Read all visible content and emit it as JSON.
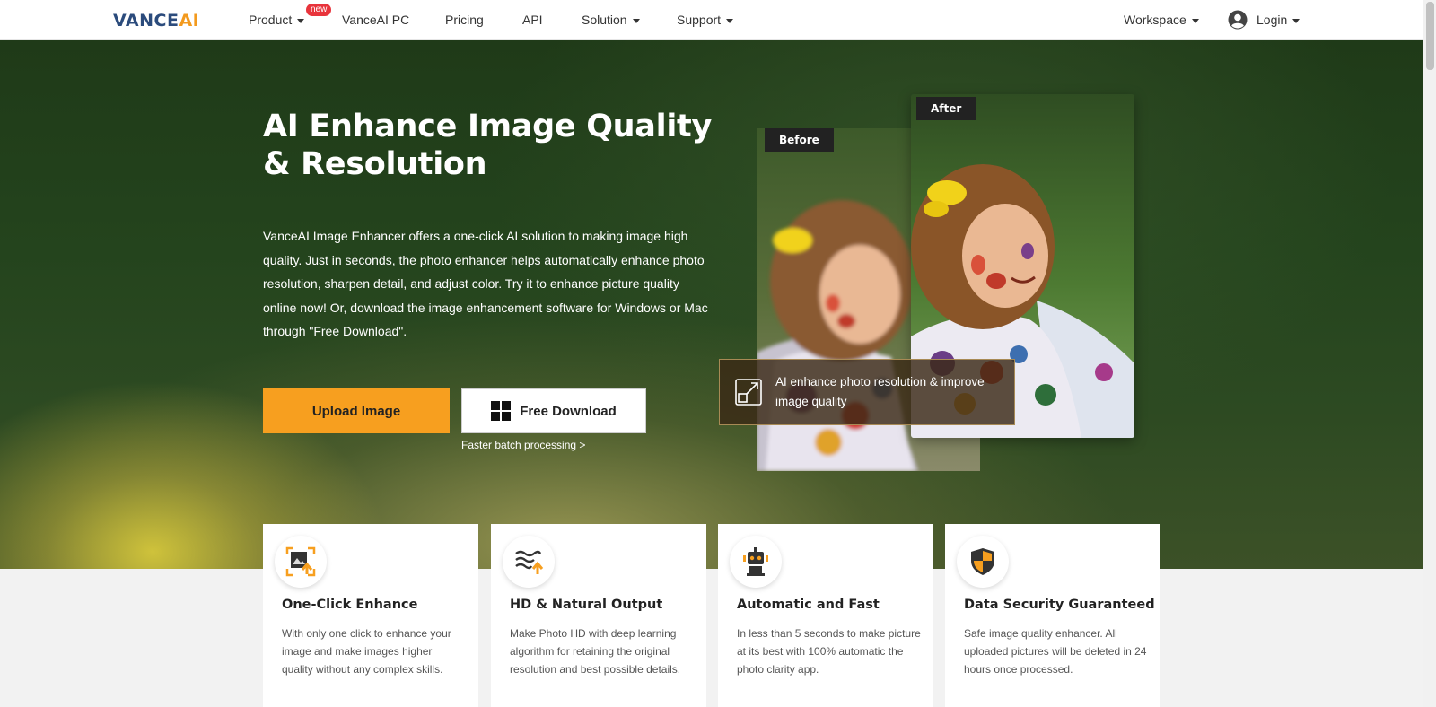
{
  "nav": {
    "logo_part1": "VANCE",
    "logo_part2": "AI",
    "product": "Product",
    "badge": "new",
    "vanceai_pc": "VanceAI PC",
    "pricing": "Pricing",
    "api": "API",
    "solution": "Solution",
    "support": "Support",
    "workspace": "Workspace",
    "login": "Login"
  },
  "hero": {
    "title": "AI Enhance Image Quality & Resolution",
    "description": "VanceAI Image Enhancer offers a one-click AI solution to making image high quality. Just in seconds, the photo enhancer helps automatically enhance photo resolution, sharpen detail, and adjust color. Try it to enhance picture quality online now! Or, download the image enhancement software for Windows or Mac through \"Free Download\".",
    "upload_label": "Upload Image",
    "download_label": "Free Download",
    "batch_link": "Faster batch processing >"
  },
  "compare": {
    "before_label": "Before",
    "after_label": "After",
    "caption": "AI enhance photo resolution & improve image quality"
  },
  "features": [
    {
      "title": "One-Click Enhance",
      "desc": "With only one click to enhance your image and make images higher quality without any complex skills.",
      "icon": "enhance-image-icon"
    },
    {
      "title": "HD & Natural Output",
      "desc": "Make Photo HD with deep learning algorithm for retaining the original resolution and best possible details.",
      "icon": "waves-upgrade-icon"
    },
    {
      "title": "Automatic and Fast",
      "desc": "In less than 5 seconds to make picture at its best with 100% automatic the photo clarity app.",
      "icon": "robot-icon"
    },
    {
      "title": "Data Security Guaranteed",
      "desc": "Safe image quality enhancer. All uploaded pictures will be deleted in 24 hours once processed.",
      "icon": "shield-icon"
    }
  ],
  "colors": {
    "accent": "#f79f1f",
    "brand_blue": "#2b4b7c",
    "badge_red": "#e8343c"
  }
}
